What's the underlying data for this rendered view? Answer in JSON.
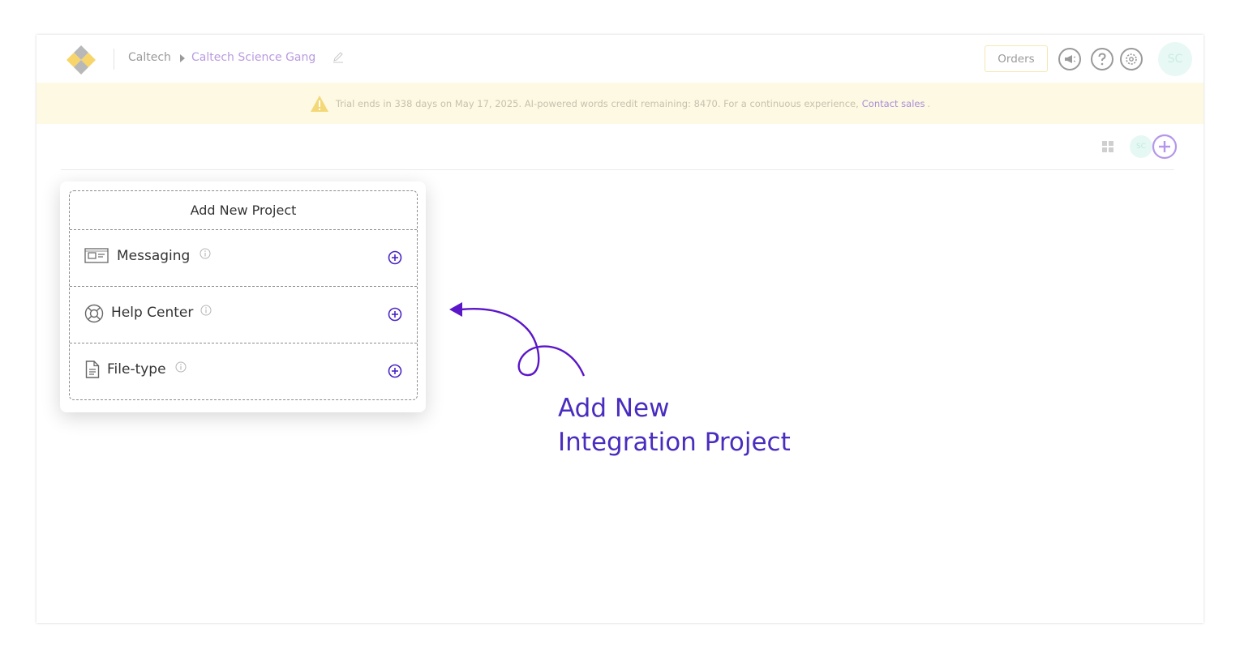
{
  "header": {
    "breadcrumb_org": "Caltech",
    "breadcrumb_workspace": "Caltech Science Gang",
    "orders_label": "Orders",
    "avatar_initials": "SC"
  },
  "banner": {
    "message": "Trial ends in 338 days on May 17, 2025. AI-powered words credit remaining: 8470. For a continuous experience,",
    "link_text": "Contact sales",
    "suffix": "."
  },
  "toolbar": {
    "mini_avatar_initials": "SC"
  },
  "popover": {
    "title": "Add New Project",
    "items": [
      {
        "label": "Messaging",
        "icon": "messaging-icon"
      },
      {
        "label": "Help Center",
        "icon": "lifebuoy-icon"
      },
      {
        "label": "File-type",
        "icon": "document-icon"
      }
    ]
  },
  "annotation": {
    "line1": "Add New",
    "line2": "Integration Project"
  },
  "colors": {
    "accent": "#5b2bd0",
    "annotation": "#4a2dbf",
    "banner_bg": "#fdf9e3",
    "workspace_link": "#b99be0"
  }
}
